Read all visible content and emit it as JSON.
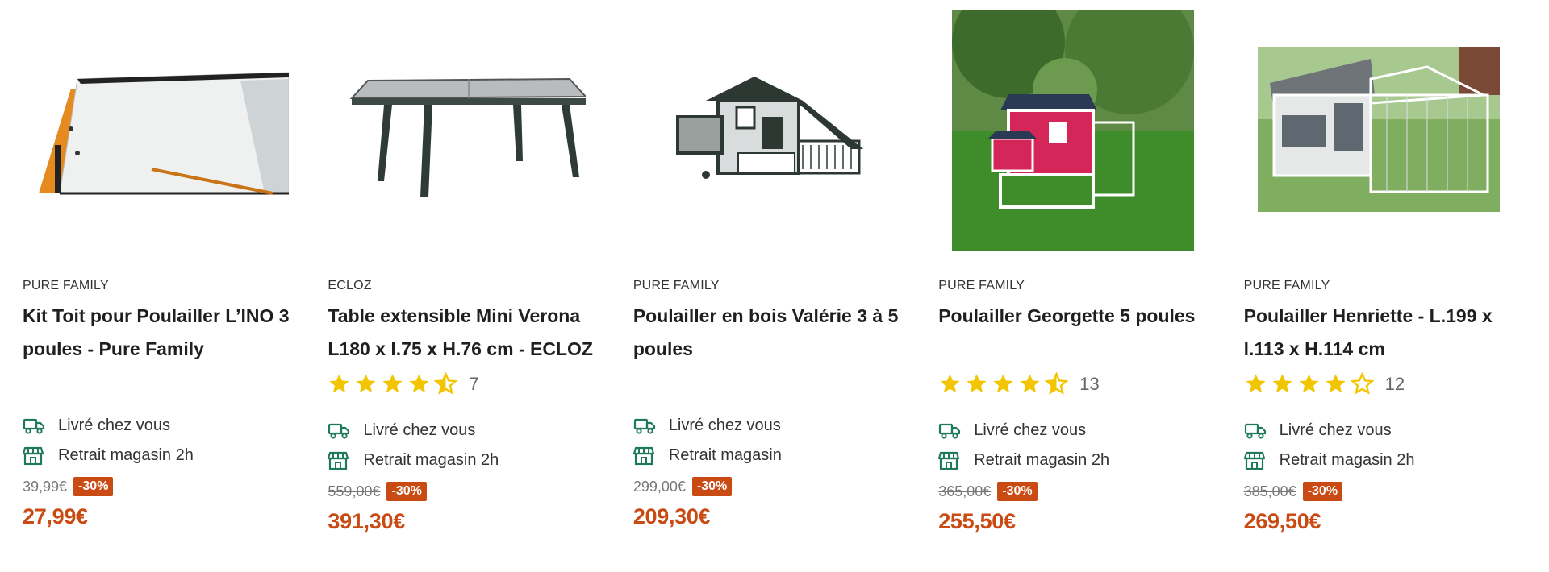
{
  "products": [
    {
      "brand": "PURE FAMILY",
      "title": "Kit Toit pour Poulailler L’INO 3 poules - Pure Family",
      "rating": null,
      "services": [
        "Livré chez vous",
        "Retrait magasin 2h"
      ],
      "old_price": "39,99€",
      "discount": "-30%",
      "price": "27,99€"
    },
    {
      "brand": "ECLOZ",
      "title": "Table extensible Mini Verona L180 x l.75 x H.76 cm - ECLOZ",
      "rating": 4.5,
      "rating_count": "7",
      "services": [
        "Livré chez vous",
        "Retrait magasin 2h"
      ],
      "old_price": "559,00€",
      "discount": "-30%",
      "price": "391,30€"
    },
    {
      "brand": "PURE FAMILY",
      "title": "Poulailler en bois Valérie 3 à 5 poules",
      "rating": null,
      "services": [
        "Livré chez vous",
        "Retrait magasin"
      ],
      "old_price": "299,00€",
      "discount": "-30%",
      "price": "209,30€"
    },
    {
      "brand": "PURE FAMILY",
      "title": "Poulailler Georgette 5 poules",
      "rating": 4.5,
      "rating_count": "13",
      "services": [
        "Livré chez vous",
        "Retrait magasin 2h"
      ],
      "old_price": "365,00€",
      "discount": "-30%",
      "price": "255,50€"
    },
    {
      "brand": "PURE FAMILY",
      "title": "Poulailler Henriette - L.199 x l.113 x H.114 cm",
      "rating": 4,
      "rating_count": "12",
      "services": [
        "Livré chez vous",
        "Retrait magasin 2h"
      ],
      "old_price": "385,00€",
      "discount": "-30%",
      "price": "269,50€"
    }
  ],
  "colors": {
    "accent": "#c94a12",
    "star": "#f2c500",
    "icon": "#1e7a5a"
  },
  "icons": {
    "delivery": "truck-icon",
    "pickup": "store-icon",
    "star": "star-icon"
  }
}
